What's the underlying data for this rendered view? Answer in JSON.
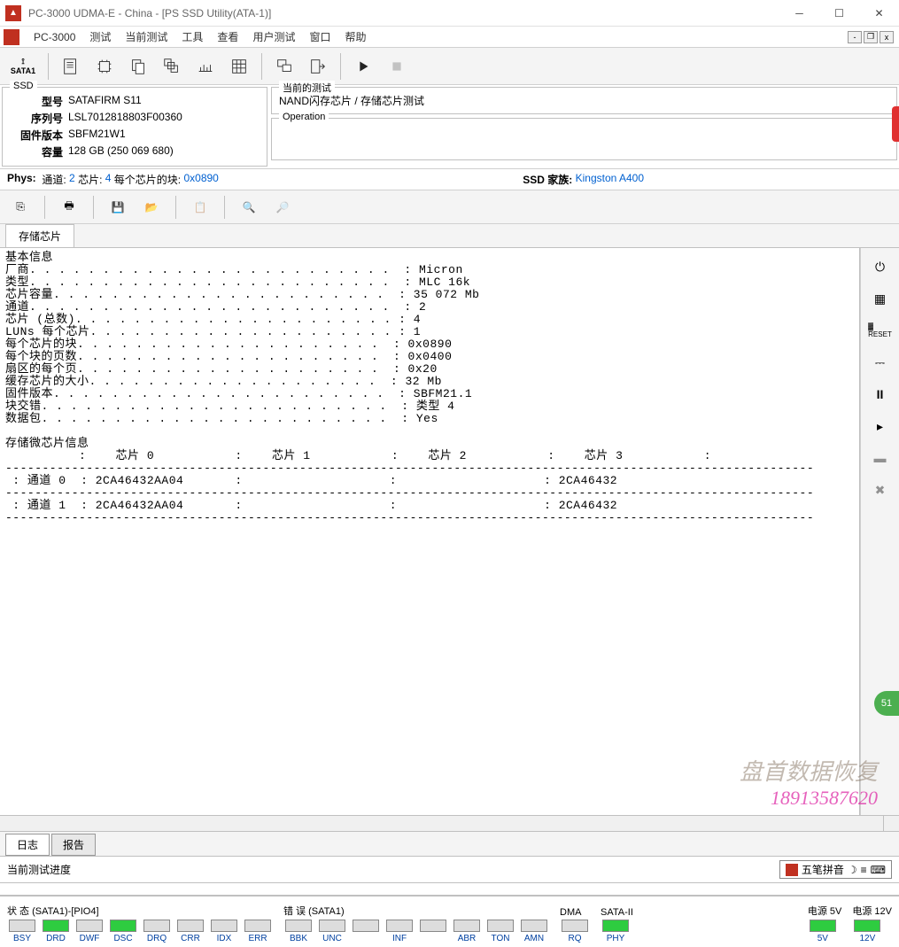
{
  "window": {
    "title": "PC-3000 UDMA-E - China - [PS SSD Utility(ATA-1)]"
  },
  "menus": {
    "app": "PC-3000",
    "items": [
      "测试",
      "当前测试",
      "工具",
      "查看",
      "用户测试",
      "窗口",
      "帮助"
    ]
  },
  "toolbar": {
    "sata": "SATA1"
  },
  "ssd_panel": {
    "legend": "SSD",
    "model_lbl": "型号",
    "model": "SATAFIRM   S11",
    "serial_lbl": "序列号",
    "serial": "LSL7012818803F00360",
    "fw_lbl": "固件版本",
    "fw": "SBFM21W1",
    "cap_lbl": "容量",
    "cap": "128 GB (250 069 680)"
  },
  "test_panel": {
    "legend": "当前的测试",
    "path": "NAND闪存芯片 / 存储芯片测试",
    "op_legend": "Operation"
  },
  "phys": {
    "label": "Phys:",
    "ch_lbl": "通道:",
    "ch_val": "2",
    "chip_lbl": "芯片:",
    "chip_val": "4",
    "blk_lbl": "每个芯片的块:",
    "blk_val": "0x0890",
    "family_lbl": "SSD 家族:",
    "family_val": "Kingston A400"
  },
  "tab": {
    "label": "存储芯片"
  },
  "info": {
    "basic_title": "基本信息",
    "rows": [
      {
        "k": "厂商",
        "v": "Micron"
      },
      {
        "k": "类型",
        "v": "MLC 16k"
      },
      {
        "k": "芯片容量",
        "v": "35 072 Mb"
      },
      {
        "k": "通道",
        "v": "2"
      },
      {
        "k": "芯片 (总数)",
        "v": "4"
      },
      {
        "k": "LUNs 每个芯片",
        "v": "1"
      },
      {
        "k": "每个芯片的块",
        "v": "0x0890"
      },
      {
        "k": "每个块的页数",
        "v": "0x0400"
      },
      {
        "k": "扇区的每个页",
        "v": "0x20"
      },
      {
        "k": "缓存芯片的大小",
        "v": "32 Mb"
      },
      {
        "k": "固件版本",
        "v": "SBFM21.1"
      },
      {
        "k": "块交错",
        "v": "类型 4"
      },
      {
        "k": "数据包",
        "v": "Yes"
      }
    ],
    "micro_title": "存储微芯片信息",
    "chip_headers": [
      "芯片 0",
      "芯片 1",
      "芯片 2",
      "芯片 3"
    ],
    "channel_rows": [
      {
        "lbl": "通道 0",
        "c0": "2CA46432AA04",
        "c1": "",
        "c2": "",
        "c3": "2CA46432"
      },
      {
        "lbl": "通道 1",
        "c0": "2CA46432AA04",
        "c1": "",
        "c2": "",
        "c3": "2CA46432"
      }
    ]
  },
  "bottom_tabs": {
    "log": "日志",
    "report": "报告"
  },
  "progress": {
    "label": "当前测试进度"
  },
  "ime": {
    "text": "五笔拼音"
  },
  "status": {
    "state_title": "状 态 (SATA1)-[PIO4]",
    "state": [
      "BSY",
      "DRD",
      "DWF",
      "DSC",
      "DRQ",
      "CRR",
      "IDX",
      "ERR"
    ],
    "state_on": [
      0,
      1,
      0,
      1,
      0,
      0,
      0,
      0
    ],
    "err_title": "错 误 (SATA1)",
    "err": [
      "BBK",
      "UNC",
      "",
      "INF",
      "",
      "ABR",
      "TON",
      "AMN"
    ],
    "dma_title": "DMA",
    "dma": [
      "RQ"
    ],
    "sata2_title": "SATA-II",
    "sata2": [
      "PHY"
    ],
    "sata2_on": [
      1
    ],
    "p5_title": "电源 5V",
    "p5": [
      "5V"
    ],
    "p5_on": [
      1
    ],
    "p12_title": "电源 12V",
    "p12": [
      "12V"
    ],
    "p12_on": [
      1
    ]
  },
  "watermark": {
    "l1": "盘首数据恢复",
    "l2": "18913587620"
  },
  "badge": "51"
}
